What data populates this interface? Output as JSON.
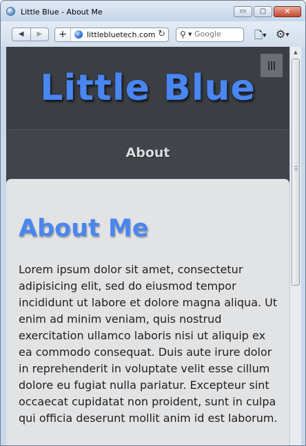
{
  "window": {
    "title": "Little Blue - About Me",
    "minimize_glyph": "▭",
    "maximize_glyph": "▢",
    "close_glyph": "✕"
  },
  "toolbar": {
    "back_glyph": "◀",
    "forward_glyph": "▶",
    "new_tab_glyph": "+",
    "url": "littlebluetech.com",
    "reload_glyph": "↻",
    "search_placeholder": "Google",
    "search_glyph": "⚲",
    "page_menu_glyph": "🗋",
    "tools_menu_glyph": "⚙",
    "dropdown_glyph": "▼"
  },
  "site": {
    "title": "Little Blue",
    "menu_toggle_icon": "hamburger-icon",
    "nav": {
      "active_item": "About"
    }
  },
  "main": {
    "heading": "About Me",
    "paragraph": "Lorem ipsum dolor sit amet, consectetur adipisicing elit, sed do eiusmod tempor incididunt ut labore et dolore magna aliqua. Ut enim ad minim veniam, quis nostrud exercitation ullamco laboris nisi ut aliquip ex ea commodo consequat. Duis aute irure dolor in reprehenderit in voluptate velit esse cillum dolore eu fugiat nulla pariatur. Excepteur sint occaecat cupidatat non proident, sunt in culpa qui officia deserunt mollit anim id est laborum."
  },
  "colors": {
    "accent_blue": "#4a86f0",
    "header_dark": "#3b3e43",
    "content_bg": "#e2e3e5",
    "nav_text": "#d9dbde"
  }
}
